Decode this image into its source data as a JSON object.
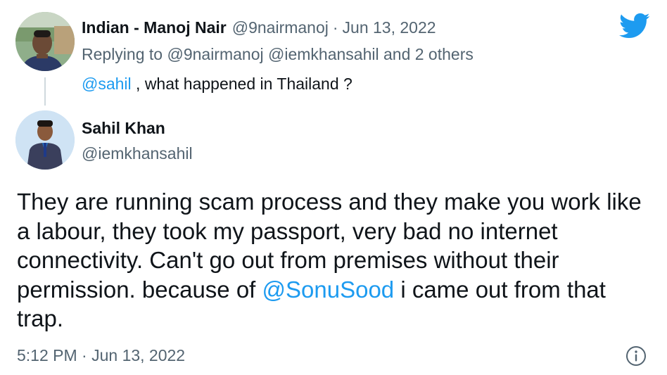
{
  "parent_tweet": {
    "display_name": "Indian - Manoj Nair",
    "handle": "@9nairmanoj",
    "separator": "·",
    "date": "Jun 13, 2022",
    "replying_prefix": "Replying to",
    "replying_mentions": "@9nairmanoj @iemkhansahil",
    "replying_suffix": "and 2 others",
    "text_mention": "@sahil",
    "text_rest": " , what happened in Thailand ?"
  },
  "reply_tweet": {
    "display_name": "Sahil Khan",
    "handle": "@iemkhansahil",
    "text_before": "They are running scam process and they make you work like a labour, they took my passport, very bad no internet connectivity. Can't go out from premises without their permission. because of ",
    "text_mention": "@SonuSood",
    "text_after": " i came out from that trap.",
    "timestamp": "5:12 PM · Jun 13, 2022"
  },
  "icons": {
    "brand": "twitter-bird-icon",
    "info": "info-icon"
  },
  "colors": {
    "link": "#1d9bf0",
    "secondary_text": "#536471",
    "primary_text": "#0f1419",
    "twitter_blue": "#1d9bf0"
  }
}
